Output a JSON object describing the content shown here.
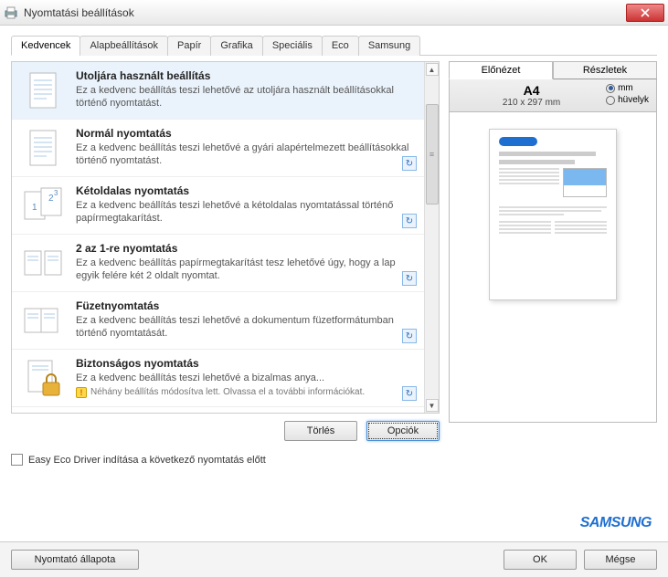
{
  "window": {
    "title": "Nyomtatási beállítások"
  },
  "tabs": [
    "Kedvencek",
    "Alapbeállítások",
    "Papír",
    "Grafika",
    "Speciális",
    "Eco",
    "Samsung"
  ],
  "activeTab": 0,
  "favorites": [
    {
      "title": "Utoljára használt beállítás",
      "desc": "Ez a kedvenc beállítás teszi lehetővé az utoljára használt beállításokkal történő nyomtatást."
    },
    {
      "title": "Normál nyomtatás",
      "desc": "Ez a kedvenc beállítás teszi lehetővé a gyári alapértelmezett beállításokkal történő nyomtatást.",
      "action": true
    },
    {
      "title": "Kétoldalas nyomtatás",
      "desc": "Ez a kedvenc beállítás teszi lehetővé a kétoldalas nyomtatással történő papírmegtakarítást.",
      "action": true
    },
    {
      "title": "2 az 1-re nyomtatás",
      "desc": "Ez a kedvenc beállítás papírmegtakarítást tesz lehetővé úgy, hogy a lap egyik felére két 2 oldalt nyomtat.",
      "action": true
    },
    {
      "title": "Füzetnyomtatás",
      "desc": "Ez a kedvenc beállítás teszi lehetővé a dokumentum füzetformátumban történő nyomtatását.",
      "action": true
    },
    {
      "title": "Biztonságos nyomtatás",
      "desc": "Ez a kedvenc beállítás teszi lehetővé a bizalmas anya...",
      "action": true,
      "warning": "Néhány beállítás módosítva lett. Olvassa el a további információkat."
    }
  ],
  "buttons": {
    "delete": "Törlés",
    "options": "Opciók"
  },
  "checkbox": {
    "label": "Easy Eco Driver indítása a következő nyomtatás előtt"
  },
  "rightTabs": {
    "preview": "Előnézet",
    "details": "Részletek"
  },
  "paper": {
    "name": "A4",
    "dim": "210 x 297 mm",
    "unit_mm": "mm",
    "unit_in": "hüvelyk"
  },
  "footer": {
    "status": "Nyomtató állapota",
    "ok": "OK",
    "cancel": "Mégse"
  },
  "brand": "SAMSUNG"
}
